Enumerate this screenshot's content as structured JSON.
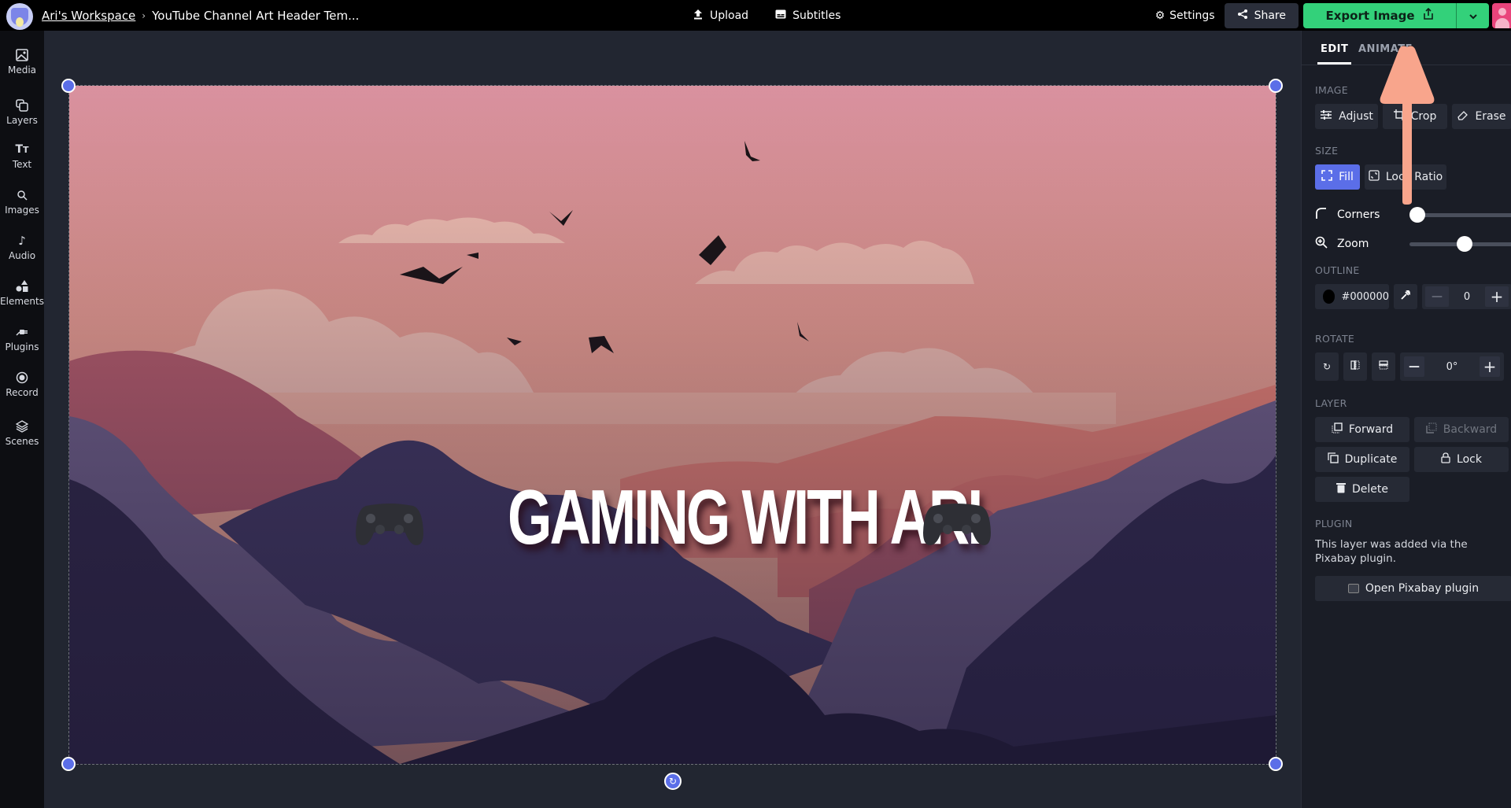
{
  "topbar": {
    "workspace": "Ari's Workspace",
    "project_title": "YouTube Channel Art Header Tem...",
    "upload_label": "Upload",
    "subtitles_label": "Subtitles",
    "settings_label": "Settings",
    "share_label": "Share",
    "export_label": "Export Image",
    "icons": {
      "avatar": "cat-avatar-icon",
      "separator": "chevron-right-icon",
      "upload": "upload-icon",
      "subtitles": "subtitles-icon",
      "settings": "gear-icon",
      "share": "share-icon",
      "export": "export-icon",
      "dropdown": "chevron-down-icon",
      "user": "user-avatar-icon"
    }
  },
  "sidebar": {
    "items": [
      {
        "label": "Media",
        "icon": "image-icon"
      },
      {
        "label": "Layers",
        "icon": "layers-icon"
      },
      {
        "label": "Text",
        "icon": "text-icon"
      },
      {
        "label": "Images",
        "icon": "search-icon"
      },
      {
        "label": "Audio",
        "icon": "music-note-icon"
      },
      {
        "label": "Elements",
        "icon": "shapes-icon"
      },
      {
        "label": "Plugins",
        "icon": "plug-icon"
      },
      {
        "label": "Record",
        "icon": "record-icon"
      },
      {
        "label": "Scenes",
        "icon": "stack-icon"
      }
    ]
  },
  "canvas": {
    "headline": "GAMING WITH ARI",
    "left_decoration": "gamepad-icon",
    "right_decoration": "gamepad-icon",
    "background": "sunset-mountains-illustration"
  },
  "panel": {
    "tabs": [
      {
        "label": "EDIT",
        "active": true
      },
      {
        "label": "ANIMATE",
        "active": false
      }
    ],
    "image": {
      "label": "IMAGE",
      "buttons": [
        "Adjust",
        "Crop",
        "Erase"
      ]
    },
    "size": {
      "label": "SIZE",
      "fill_label": "Fill",
      "lock_ratio_label": "Lock Ratio",
      "fill_active": true
    },
    "corners": {
      "label": "Corners",
      "value_fraction": 0.0
    },
    "zoom": {
      "label": "Zoom",
      "value_fraction": 0.5
    },
    "outline": {
      "label": "OUTLINE",
      "color_hex": "#000000",
      "width_value": "0"
    },
    "rotate": {
      "label": "ROTATE",
      "value": "0°"
    },
    "layer": {
      "label": "LAYER",
      "forward": "Forward",
      "backward": "Backward",
      "backward_disabled": true,
      "duplicate": "Duplicate",
      "lock": "Lock",
      "delete": "Delete"
    },
    "plugin": {
      "label": "PLUGIN",
      "description": "This layer was added via the Pixabay plugin.",
      "open_label": "Open Pixabay plugin"
    }
  },
  "colors": {
    "accent": "#5b6ee8",
    "export_green": "#33d17a",
    "annotation_arrow": "#f8a58c"
  }
}
